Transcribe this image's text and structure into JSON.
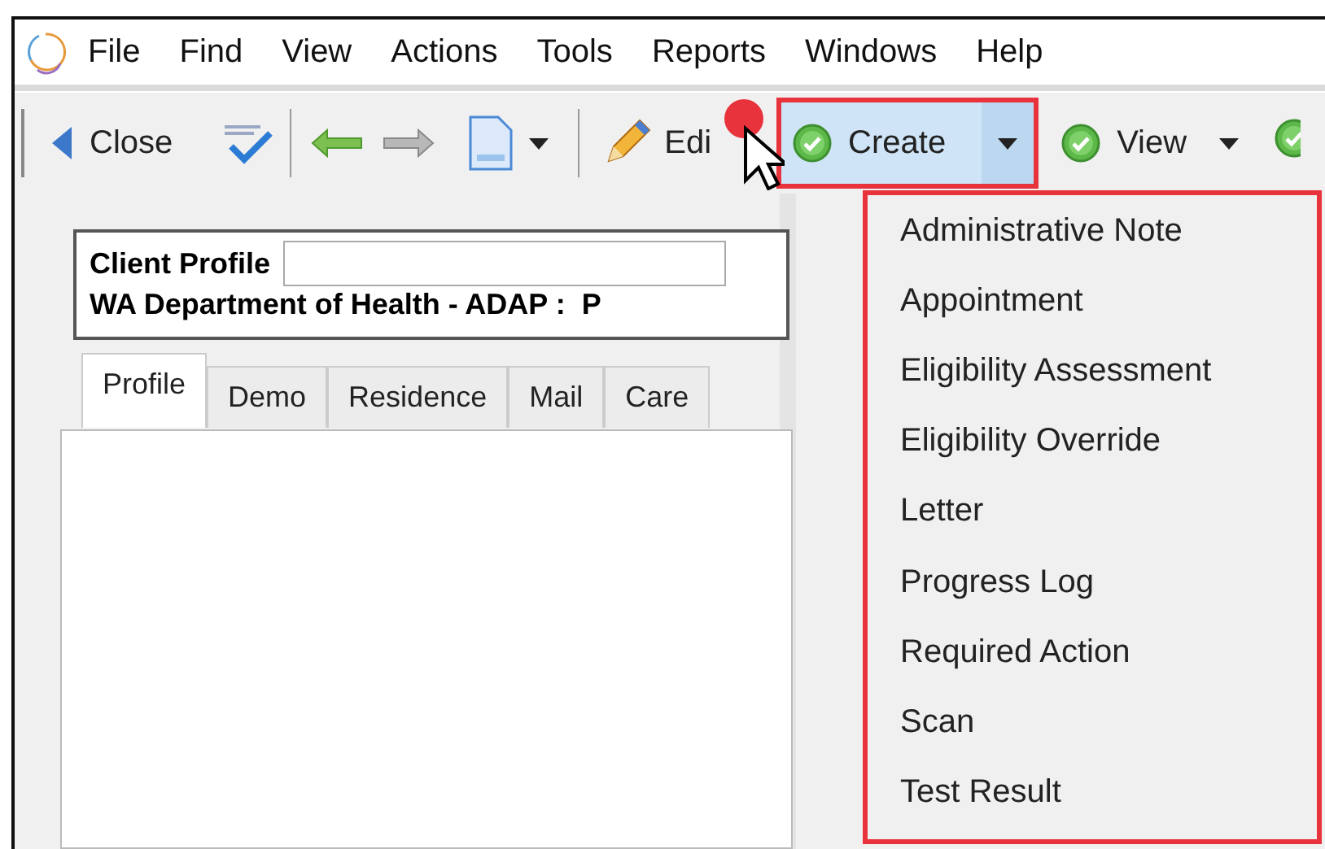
{
  "menu_bar": {
    "items": [
      "File",
      "Find",
      "View",
      "Actions",
      "Tools",
      "Reports",
      "Windows",
      "Help"
    ]
  },
  "toolbar": {
    "close": "Close",
    "edit": "Edi",
    "create": {
      "label": "Create",
      "selected": true,
      "expanded": true
    },
    "view": "View"
  },
  "client_header": {
    "title": "Client Profile",
    "subtitle": "WA Department of Health - ADAP :  P"
  },
  "tabs": [
    {
      "label": "Profile",
      "selected": true
    },
    {
      "label": "Demo",
      "selected": false
    },
    {
      "label": "Residence",
      "selected": false
    },
    {
      "label": "Mail",
      "selected": false
    },
    {
      "label": "Care",
      "selected": false
    }
  ],
  "create_menu": {
    "items": [
      "Administrative Note",
      "Appointment",
      "Eligibility Assessment",
      "Eligibility Override",
      "Letter",
      "Progress Log",
      "Required Action",
      "Scan",
      "Test Result"
    ]
  }
}
